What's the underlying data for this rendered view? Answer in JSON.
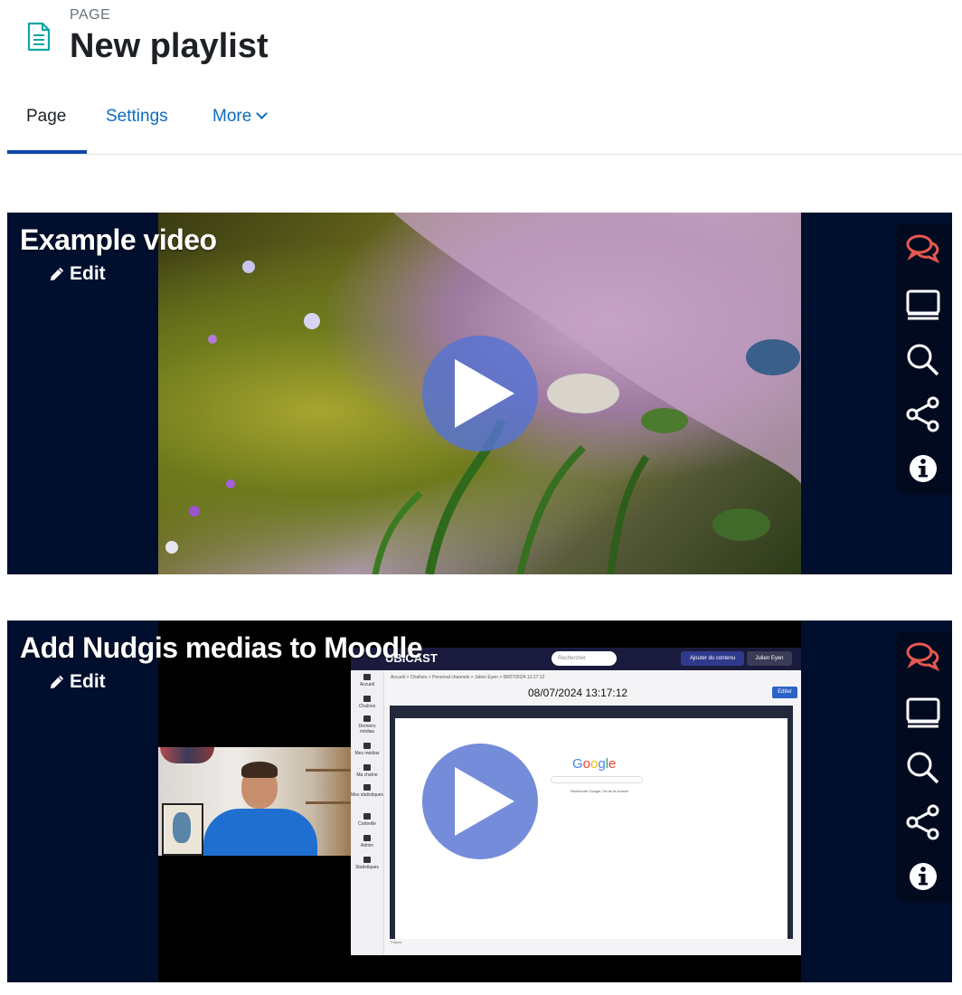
{
  "header": {
    "kicker": "PAGE",
    "title": "New playlist"
  },
  "tabs": [
    {
      "label": "Page",
      "active": true
    },
    {
      "label": "Settings",
      "active": false
    },
    {
      "label": "More",
      "active": false
    }
  ],
  "videos": [
    {
      "title": "Example video",
      "edit_label": "Edit"
    },
    {
      "title": "Add Nudgis medias to Moodle",
      "edit_label": "Edit",
      "screen": {
        "brand": "UBICAST",
        "search_placeholder": "Rechercher",
        "add_content": "Ajouter du contenu",
        "user": "Julien Eyen",
        "breadcrumb": "Accueil > Chaînes > Personal channels > Julien Eyen > 08/07/2024 13:17:12",
        "date_title": "08/07/2024 13:17:12",
        "edit": "Editer",
        "sidebar": [
          "Accueil",
          "Chaînes",
          "Derniers médias",
          "Mes médias",
          "Ma chaîne",
          "Mes statistiques",
          "Corbeille",
          "Admin",
          "Statistiques"
        ],
        "google": "Google",
        "google_buttons": "Recherche Google   J'ai de la chance",
        "footer": "France"
      }
    }
  ],
  "toolbar_icons": [
    "comments-icon",
    "slides-icon",
    "search-icon",
    "share-icon",
    "info-icon"
  ],
  "colors": {
    "accent": "#0f6cbf",
    "tab_underline": "#0f47ad",
    "player_bg": "#010f2e",
    "comments_icon": "#e5584f",
    "play_button": "#5573d2"
  }
}
